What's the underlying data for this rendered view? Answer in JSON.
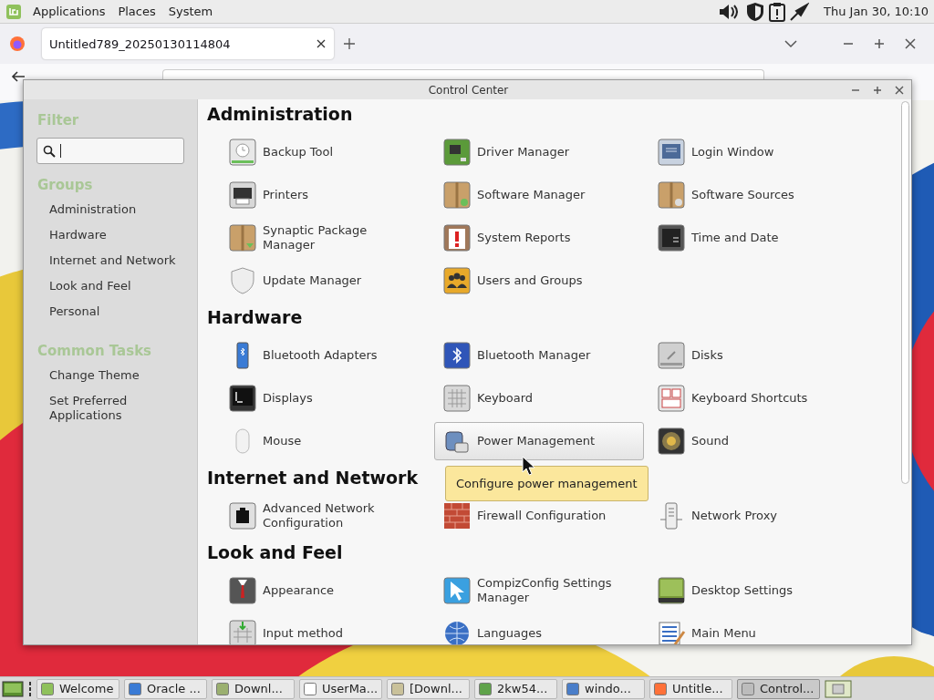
{
  "top_panel": {
    "menus": [
      "Applications",
      "Places",
      "System"
    ],
    "clock": "Thu Jan 30, 10:10"
  },
  "browser": {
    "tab_title": "Untitled789_20250130114804"
  },
  "control_center": {
    "title": "Control Center",
    "sidebar": {
      "filter_heading": "Filter",
      "search_field": {
        "focused": true
      },
      "groups_heading": "Groups",
      "groups": [
        "Administration",
        "Hardware",
        "Internet and Network",
        "Look and Feel",
        "Personal"
      ],
      "tasks_heading": "Common Tasks",
      "tasks": [
        "Change Theme",
        "Set Preferred Applications"
      ]
    },
    "sections": [
      {
        "title": "Administration",
        "items": [
          {
            "label": "Backup Tool",
            "hovered": false
          },
          {
            "label": "Driver Manager",
            "hovered": false
          },
          {
            "label": "Login Window",
            "hovered": false
          },
          {
            "label": "Printers",
            "hovered": false
          },
          {
            "label": "Software Manager",
            "hovered": false
          },
          {
            "label": "Software Sources",
            "hovered": false
          },
          {
            "label": "Synaptic Package Manager",
            "hovered": false
          },
          {
            "label": "System Reports",
            "hovered": false
          },
          {
            "label": "Time and Date",
            "hovered": false
          },
          {
            "label": "Update Manager",
            "hovered": false
          },
          {
            "label": "Users and Groups",
            "hovered": false
          }
        ]
      },
      {
        "title": "Hardware",
        "items": [
          {
            "label": "Bluetooth Adapters",
            "hovered": false
          },
          {
            "label": "Bluetooth Manager",
            "hovered": false
          },
          {
            "label": "Disks",
            "hovered": false
          },
          {
            "label": "Displays",
            "hovered": false
          },
          {
            "label": "Keyboard",
            "hovered": false
          },
          {
            "label": "Keyboard Shortcuts",
            "hovered": false
          },
          {
            "label": "Mouse",
            "hovered": false
          },
          {
            "label": "Power Management",
            "hovered": true
          },
          {
            "label": "Sound",
            "hovered": false
          }
        ]
      },
      {
        "title": "Internet and Network",
        "items": [
          {
            "label": "Advanced Network Configuration",
            "hovered": false
          },
          {
            "label": "Firewall Configuration",
            "hovered": false
          },
          {
            "label": "Network Proxy",
            "hovered": false
          }
        ]
      },
      {
        "title": "Look and Feel",
        "items": [
          {
            "label": "Appearance",
            "hovered": false
          },
          {
            "label": "CompizConfig Settings Manager",
            "hovered": false
          },
          {
            "label": "Desktop Settings",
            "hovered": false
          },
          {
            "label": "Input method",
            "hovered": false
          },
          {
            "label": "Languages",
            "hovered": false
          },
          {
            "label": "Main Menu",
            "hovered": false
          }
        ]
      }
    ],
    "tooltip": "Configure power management"
  },
  "taskbar": {
    "tasks": [
      {
        "label": "Welcome",
        "selected": false
      },
      {
        "label": "Oracle ...",
        "selected": false
      },
      {
        "label": "Downl...",
        "selected": false
      },
      {
        "label": "UserMa...",
        "selected": false
      },
      {
        "label": "[Downl...",
        "selected": false
      },
      {
        "label": "2kw54...",
        "selected": false
      },
      {
        "label": "windo...",
        "selected": false
      },
      {
        "label": "Untitle...",
        "selected": false
      },
      {
        "label": "Control...",
        "selected": true
      }
    ]
  }
}
